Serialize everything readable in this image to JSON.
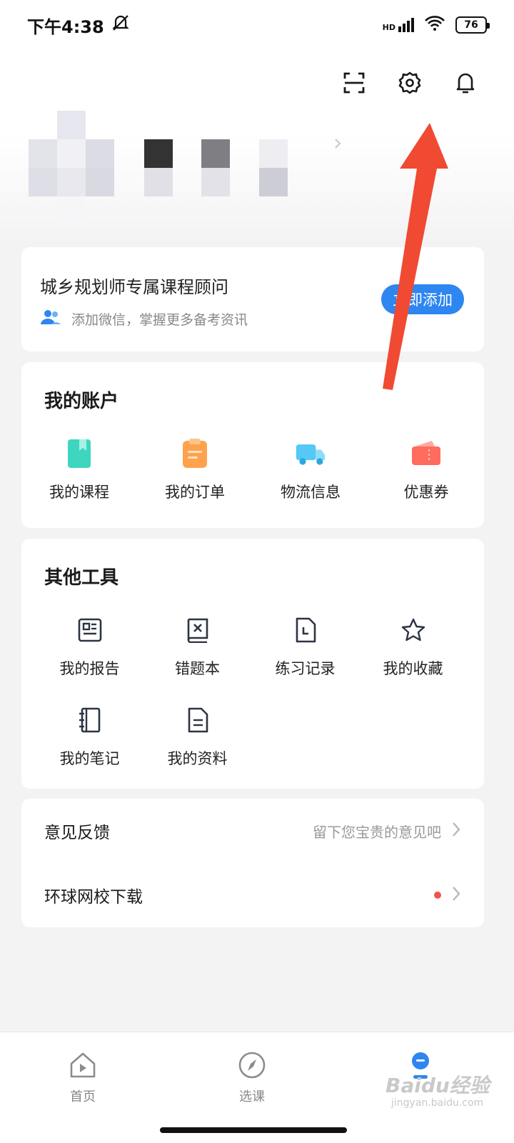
{
  "status_bar": {
    "time": "下午4:38",
    "network": "HD",
    "battery": "76"
  },
  "toolbar": {
    "icons": [
      "scan-icon",
      "settings-icon",
      "bell-icon"
    ]
  },
  "consult_card": {
    "title": "城乡规划师专属课程顾问",
    "subtitle": "添加微信，掌握更多备考资讯",
    "button": "立即添加"
  },
  "account": {
    "title": "我的账户",
    "items": [
      {
        "label": "我的课程",
        "icon": "course-book-icon",
        "color": "#3fd6bf"
      },
      {
        "label": "我的订单",
        "icon": "order-clipboard-icon",
        "color": "#ffa24d"
      },
      {
        "label": "物流信息",
        "icon": "delivery-truck-icon",
        "color": "#56c8f5"
      },
      {
        "label": "优惠券",
        "icon": "coupon-ticket-icon",
        "color": "#ff6b5c"
      }
    ]
  },
  "tools": {
    "title": "其他工具",
    "items": [
      {
        "label": "我的报告",
        "icon": "report-icon"
      },
      {
        "label": "错题本",
        "icon": "mistake-book-icon"
      },
      {
        "label": "练习记录",
        "icon": "practice-record-icon"
      },
      {
        "label": "我的收藏",
        "icon": "star-icon"
      },
      {
        "label": "我的笔记",
        "icon": "notebook-icon"
      },
      {
        "label": "我的资料",
        "icon": "document-icon"
      }
    ]
  },
  "list": {
    "feedback": {
      "title": "意见反馈",
      "hint": "留下您宝贵的意见吧"
    },
    "download": {
      "title": "环球网校下载"
    }
  },
  "bottom_nav": {
    "items": [
      {
        "label": "首页",
        "icon": "home-icon"
      },
      {
        "label": "选课",
        "icon": "compass-icon"
      },
      {
        "label": "",
        "icon": "profile-icon"
      }
    ]
  },
  "watermark": {
    "text": "Baidu经验",
    "sub": "jingyan.baidu.com"
  },
  "colors": {
    "accent": "#2e86f0",
    "arrow": "#f04a32"
  }
}
